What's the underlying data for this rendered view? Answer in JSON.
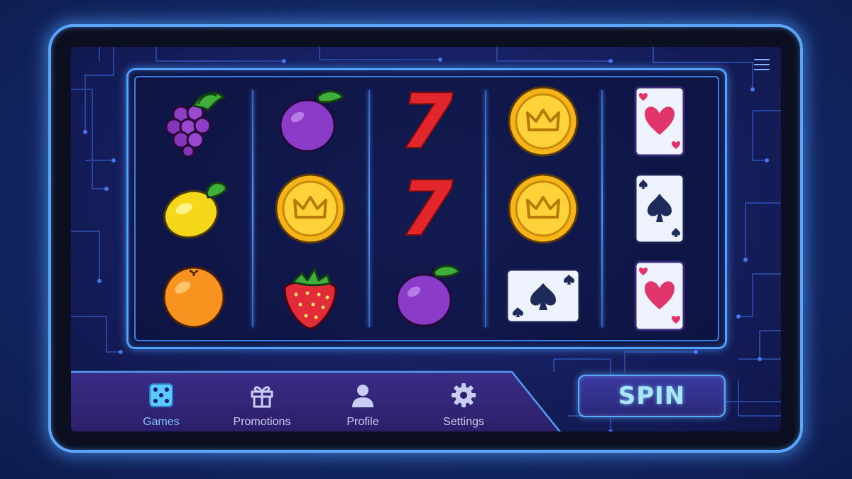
{
  "colors": {
    "accent": "#5aa6ff",
    "active_nav": "#7ec4ff",
    "spin_text": "#a9e6ff"
  },
  "reels": [
    [
      "grapes",
      "lemon",
      "orange"
    ],
    [
      "plum",
      "gold-crown-coin",
      "strawberry"
    ],
    [
      "red-seven",
      "red-seven",
      "plum"
    ],
    [
      "gold-crown-coin",
      "gold-crown-coin",
      "ace-of-spades-card"
    ],
    [
      "heart-card",
      "spade-card",
      "heart-card"
    ]
  ],
  "symbols": {
    "seven": "7"
  },
  "nav": {
    "items": [
      {
        "label": "Games",
        "icon": "dice-icon",
        "active": true
      },
      {
        "label": "Promotions",
        "icon": "gift-icon",
        "active": false
      },
      {
        "label": "Profile",
        "icon": "user-icon",
        "active": false
      },
      {
        "label": "Settings",
        "icon": "gear-icon",
        "active": false
      }
    ]
  },
  "spin_button": {
    "label": "SPIN"
  },
  "menu": {
    "icon": "hamburger-icon"
  }
}
